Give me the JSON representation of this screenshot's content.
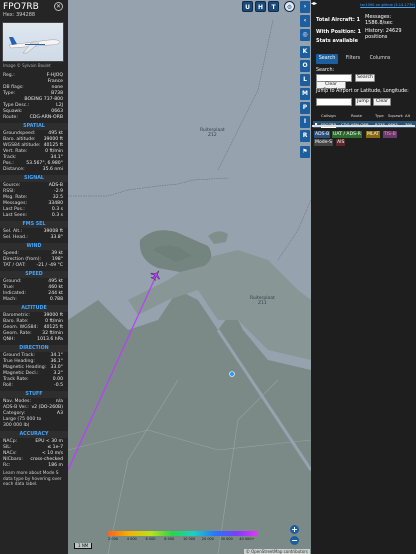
{
  "aircraft": {
    "callsign": "FPO7RB",
    "hex_line": "Hex: 394288",
    "photo_credit": "Image © Sylvain Boulet",
    "fields": [
      {
        "k": "Reg.:",
        "v": "F-HJOQ"
      },
      {
        "k": "",
        "v": "France"
      },
      {
        "k": "DB flags:",
        "v": "none"
      },
      {
        "k": "Type:",
        "v": "B738"
      },
      {
        "k": "",
        "v": "BOEING 737-800"
      },
      {
        "k": "Type Desc.:",
        "v": "L2J"
      },
      {
        "k": "Squawk:",
        "v": "0663"
      },
      {
        "k": "Route:",
        "v": "CDG-ARN-ORB"
      }
    ]
  },
  "sections": {
    "spatial": {
      "title": "SPATIAL",
      "rows": [
        {
          "k": "Groundspeed:",
          "v": "495 kt"
        },
        {
          "k": "Baro. altitude:",
          "v": "39000 ft"
        },
        {
          "k": "WGS84 altitude:",
          "v": "40125 ft"
        },
        {
          "k": "Vert. Rate:",
          "v": "0 ft/min"
        },
        {
          "k": "Track:",
          "v": "34.1°"
        },
        {
          "k": "Pos.:",
          "v": "53.567°, 6.980°"
        },
        {
          "k": "Distance:",
          "v": "35.6 nmi"
        }
      ]
    },
    "signal": {
      "title": "SIGNAL",
      "rows": [
        {
          "k": "Source:",
          "v": "ADS-B"
        },
        {
          "k": "RSSI:",
          "v": "-2.9"
        },
        {
          "k": "Msg. Rate:",
          "v": "32.5"
        },
        {
          "k": "Messages:",
          "v": "33480"
        },
        {
          "k": "Last Pos.:",
          "v": "0.3 s"
        },
        {
          "k": "Last Seen:",
          "v": "0.3 s"
        }
      ]
    },
    "fms": {
      "title": "FMS SEL",
      "rows": [
        {
          "k": "Sel. Alt.:",
          "v": "39008 ft"
        },
        {
          "k": "Sel. Head.:",
          "v": "33.8°"
        }
      ]
    },
    "wind": {
      "title": "WIND",
      "rows": [
        {
          "k": "Speed:",
          "v": "39 kt"
        },
        {
          "k": "Direction (from):",
          "v": "198°"
        },
        {
          "k": "TAT / OAT:",
          "v": "-21 / -49 °C"
        }
      ]
    },
    "speed": {
      "title": "SPEED",
      "rows": [
        {
          "k": "Ground:",
          "v": "495 kt"
        },
        {
          "k": "True:",
          "v": "460 kt"
        },
        {
          "k": "Indicated:",
          "v": "244 kt"
        },
        {
          "k": "Mach:",
          "v": "0.788"
        }
      ]
    },
    "altitude": {
      "title": "ALTITUDE",
      "rows": [
        {
          "k": "Barometric:",
          "v": "39000 ft"
        },
        {
          "k": "Baro. Rate:",
          "v": "0 ft/min"
        },
        {
          "k": "Geom. WGS84:",
          "v": "40125 ft"
        },
        {
          "k": "Geom. Rate:",
          "v": "32 ft/min"
        },
        {
          "k": "QNH:",
          "v": "1013.6 hPa"
        }
      ]
    },
    "direction": {
      "title": "DIRECTION",
      "rows": [
        {
          "k": "Ground Track:",
          "v": "34.1°"
        },
        {
          "k": "True Heading:",
          "v": "36.1°"
        },
        {
          "k": "Magnetic Heading:",
          "v": "33.0°"
        },
        {
          "k": "Magnetic Decl.:",
          "v": "3.2°"
        },
        {
          "k": "Track Rate:",
          "v": "0.00"
        },
        {
          "k": "Roll:",
          "v": "-0.5"
        }
      ]
    },
    "stuff": {
      "title": "STUFF",
      "rows": [
        {
          "k": "Nav. Modes:",
          "v": "n/a"
        },
        {
          "k": "ADS-B Ver.:",
          "v": "v2 (DO-260B)"
        },
        {
          "k": "Category:",
          "v": "A3"
        },
        {
          "k": "Large (75 000 to",
          "v": ""
        },
        {
          "k": "300 000 lb)",
          "v": ""
        }
      ]
    },
    "accuracy": {
      "title": "ACCURACY",
      "rows": [
        {
          "k": "NACp:",
          "v": "EPU < 30 m"
        },
        {
          "k": "SIL:",
          "v": "≤ 1e-7"
        },
        {
          "k": "NACv:",
          "v": "< 10 m/s"
        },
        {
          "k": "NICbaro:",
          "v": "cross-checked"
        },
        {
          "k": "Rc:",
          "v": "186 m"
        }
      ]
    },
    "note": "Learn more about Mode S data type by hovering over each data label."
  },
  "map": {
    "buttons": [
      "U",
      "H",
      "T"
    ],
    "vertical_buttons": [
      "K",
      "O",
      "L",
      "M",
      "P",
      "I",
      "R"
    ],
    "labels": {
      "place1": "Ruiterplaat",
      "place1b": "Z12",
      "place2": "Ruiterplaat",
      "place2b": "Z11"
    },
    "scale_label": "1 NM",
    "attribution": "© OpenStreetMap contributors",
    "alt_ticks": [
      "2 000",
      "4 000",
      "6 000",
      "8 000",
      "10 000",
      "20 000",
      "30 000",
      "40 000+"
    ],
    "colors": {
      "water": "#96a2ad",
      "land": "#7b8a86",
      "track": "#b83dff"
    }
  },
  "side": {
    "github": "tar1090 on github (3.14.1779)",
    "total_label": "Total Aircraft: 1",
    "with_pos": "With Position: 1",
    "stats_available": "Stats available",
    "messages_label": "Messages:",
    "messages_rate": "1586.8/sec",
    "history_label": "History: 24629",
    "history_unit": "positions",
    "tabs": [
      "Search",
      "Filters",
      "Columns"
    ],
    "search_label": "Search:",
    "search_button": "Search",
    "clear_search": "Clear Search",
    "jump_label": "Jump to Airport or Latitude, Longitude:",
    "jump_button": "Jump",
    "clear_button": "Clear",
    "table": {
      "headers": [
        "Callsign",
        "Route",
        "Type",
        "Squawk",
        "Alt"
      ],
      "row": [
        "FPO7RB",
        "CDG-ARN-ORB",
        "B738",
        "0663",
        "390"
      ]
    },
    "legend": [
      "ADS-B",
      "UAT / ADS-R",
      "MLAT",
      "TIS-B",
      "Mode-S",
      "AIS"
    ]
  }
}
